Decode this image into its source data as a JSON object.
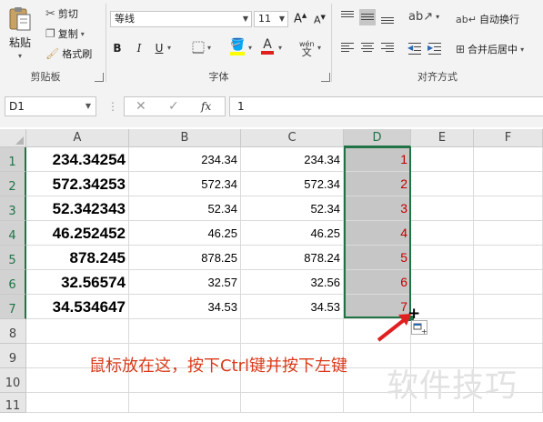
{
  "ribbon": {
    "clipboard": {
      "paste": "粘贴",
      "cut": "剪切",
      "copy": "复制",
      "format_painter": "格式刷",
      "label": "剪贴板"
    },
    "font": {
      "name": "等线",
      "size": "11",
      "label": "字体",
      "bold": "B",
      "italic": "I",
      "underline": "U",
      "font_color_glyph": "A",
      "phonetic": "wén"
    },
    "alignment": {
      "wrap_text": "自动换行",
      "merge_center": "合并后居中",
      "label": "对齐方式"
    }
  },
  "formula_bar": {
    "name_box": "D1",
    "fx": "fx",
    "cancel": "✕",
    "enter": "✓",
    "value": "1"
  },
  "columns": [
    "A",
    "B",
    "C",
    "D",
    "E",
    "F"
  ],
  "rows": [
    "1",
    "2",
    "3",
    "4",
    "5",
    "6",
    "7",
    "8",
    "9",
    "10",
    "11"
  ],
  "cells": {
    "A": [
      "234.34254",
      "572.34253",
      "52.342343",
      "46.252452",
      "878.245",
      "32.56574",
      "34.534647"
    ],
    "B": [
      "234.34",
      "572.34",
      "52.34",
      "46.25",
      "878.25",
      "32.57",
      "34.53"
    ],
    "C": [
      "234.34",
      "572.34",
      "52.34",
      "46.25",
      "878.24",
      "32.56",
      "34.53"
    ],
    "D": [
      "1",
      "2",
      "3",
      "4",
      "5",
      "6",
      "7"
    ]
  },
  "selection": "D1:D7",
  "annotation": {
    "text": "鼠标放在这，按下Ctrl键并按下左键",
    "color": "#d93a1a"
  },
  "watermark": "软件技巧",
  "colors": {
    "accent": "#217346",
    "selected_value": "#c00000"
  }
}
